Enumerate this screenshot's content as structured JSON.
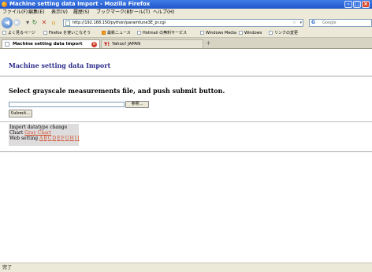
{
  "window": {
    "title": "Machine setting data Import - Mozilla Firefox"
  },
  "menubar": [
    "ファイル(F)",
    "編集(E)",
    "表示(V)",
    "履歴(S)",
    "ブックマーク(B)",
    "ツール(T)",
    "ヘルプ(H)"
  ],
  "navigation": {
    "url": "http://192.168.150/python/paramtune3E_pr.cgi",
    "search_placeholder": "Google"
  },
  "bookmarks": [
    "よく見るページ",
    "Firefox を使いこなそう",
    "最新ニュース",
    "Hotmail の無料サービス",
    "Windows Media",
    "Windows",
    "リンクの変更"
  ],
  "tabs": [
    {
      "label": "Machine setting data Import"
    },
    {
      "label": "Yahoo! JAPAN"
    }
  ],
  "page": {
    "title": "Machine setting data Import",
    "instruction": "Select grayscale measurements file, and push submit button.",
    "browse_label": "参照...",
    "submit_label": "Submit...",
    "panel": {
      "import_label": "Import datatype change",
      "chart_prefix": "Chart",
      "chart_link": "Gray Chart",
      "web_prefix": "Web setting",
      "letters": [
        "A",
        "B",
        "C",
        "D",
        "E",
        "F",
        "G",
        "H",
        "I",
        "J"
      ]
    }
  },
  "status": {
    "text": "完了"
  }
}
